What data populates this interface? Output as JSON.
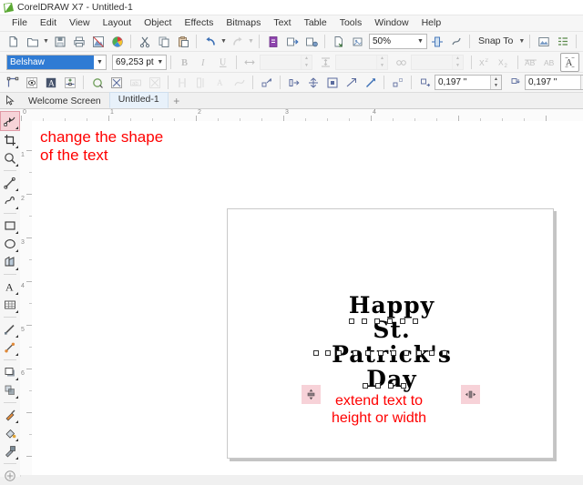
{
  "window": {
    "title": "CorelDRAW X7 - Untitled-1",
    "app_icon": "coreldraw-logo-icon"
  },
  "menubar": {
    "items": [
      {
        "label": "File"
      },
      {
        "label": "Edit"
      },
      {
        "label": "View"
      },
      {
        "label": "Layout"
      },
      {
        "label": "Object"
      },
      {
        "label": "Effects"
      },
      {
        "label": "Bitmaps"
      },
      {
        "label": "Text"
      },
      {
        "label": "Table"
      },
      {
        "label": "Tools"
      },
      {
        "label": "Window"
      },
      {
        "label": "Help"
      }
    ]
  },
  "standard_toolbar": {
    "buttons": [
      {
        "name": "new-document-button",
        "icon": "new-page-icon"
      },
      {
        "name": "open-document-button",
        "icon": "folder-open-icon"
      },
      {
        "name": "save-document-button",
        "icon": "floppy-disk-icon"
      },
      {
        "name": "print-button",
        "icon": "printer-icon"
      },
      {
        "name": "publish-pdf-button",
        "icon": "pdf-export-icon"
      },
      {
        "name": "color-styles-button",
        "icon": "color-wheel-icon"
      },
      {
        "name": "cut-button",
        "icon": "scissors-icon"
      },
      {
        "name": "copy-button",
        "icon": "copy-icon"
      },
      {
        "name": "paste-button",
        "icon": "clipboard-paste-icon"
      },
      {
        "name": "undo-button",
        "icon": "undo-arrow-icon"
      },
      {
        "name": "redo-button",
        "icon": "redo-arrow-icon"
      },
      {
        "name": "import-button",
        "icon": "import-icon"
      },
      {
        "name": "export-button",
        "icon": "export-icon"
      },
      {
        "name": "export-to-button",
        "icon": "export-to-icon"
      },
      {
        "name": "application-launcher-button",
        "icon": "launcher-icon"
      },
      {
        "name": "corel-connect-button",
        "icon": "connect-icon"
      }
    ],
    "zoom_level": "50%",
    "snap_to_label": "Snap To",
    "right_buttons": [
      {
        "name": "full-screen-preview-button",
        "icon": "preview-icon"
      },
      {
        "name": "object-manager-button",
        "icon": "object-list-icon"
      },
      {
        "name": "options-button",
        "icon": "options-icon"
      },
      {
        "name": "duplicate-distance-button",
        "icon": "duplicate-icon"
      }
    ]
  },
  "text_property_bar": {
    "font_name": "Belshaw",
    "font_size": "69,253 pt",
    "bold_label": "B",
    "italic_label": "I",
    "underline_label": "U",
    "character_spacing_value": "",
    "line_spacing_value": "",
    "word_spacing_value": "",
    "superscript_label": "X²",
    "subscript_label": "X₂",
    "all_caps_label": "AB",
    "small_caps_label": "AB",
    "buttons": [
      {
        "name": "bold-button",
        "icon": "bold-icon"
      },
      {
        "name": "italic-button",
        "icon": "italic-icon"
      },
      {
        "name": "underline-button",
        "icon": "underline-icon"
      },
      {
        "name": "character-spacing-field",
        "icon": "character-spacing-icon"
      },
      {
        "name": "line-spacing-field",
        "icon": "line-spacing-icon"
      },
      {
        "name": "word-spacing-field",
        "icon": "word-spacing-icon"
      },
      {
        "name": "superscript-button",
        "icon": "superscript-icon"
      },
      {
        "name": "subscript-button",
        "icon": "subscript-icon"
      },
      {
        "name": "uppercase-button",
        "icon": "uppercase-icon"
      },
      {
        "name": "small-caps-button",
        "icon": "small-caps-icon"
      },
      {
        "name": "character-panel-button",
        "icon": "character-panel-icon"
      },
      {
        "name": "add-option-button",
        "icon": "plus-circle-icon"
      }
    ]
  },
  "shape_property_bar": {
    "nudge_horizontal": "0,197 \"",
    "nudge_vertical": "0,197 \"",
    "buttons": [
      {
        "name": "select-all-nodes-button",
        "icon": "select-nodes-icon"
      },
      {
        "name": "preview-nodes-button",
        "icon": "nodes-grid-icon"
      },
      {
        "name": "convert-to-curves-button",
        "icon": "text-curve-icon"
      },
      {
        "name": "add-node-button",
        "icon": "add-node-icon"
      },
      {
        "name": "reduce-nodes-button",
        "icon": "reduce-node-icon"
      },
      {
        "name": "delete-node-button",
        "icon": "delete-node-icon"
      },
      {
        "name": "join-nodes-button",
        "icon": "join-nodes-icon"
      },
      {
        "name": "break-curve-button",
        "icon": "break-curve-icon"
      },
      {
        "name": "line-to-curve-button",
        "icon": "line-to-curve-icon"
      },
      {
        "name": "curve-to-line-button",
        "icon": "curve-to-line-icon"
      },
      {
        "name": "make-node-cusp-button",
        "icon": "cusp-node-icon"
      },
      {
        "name": "make-node-smooth-button",
        "icon": "smooth-node-icon"
      },
      {
        "name": "make-node-symmetric-button",
        "icon": "symmetric-node-icon"
      },
      {
        "name": "reverse-direction-button",
        "icon": "reverse-direction-icon"
      },
      {
        "name": "extend-curve-button",
        "icon": "extend-curve-icon"
      },
      {
        "name": "close-curve-button",
        "icon": "close-curve-icon"
      },
      {
        "name": "stretch-nodes-button",
        "icon": "stretch-nodes-icon"
      },
      {
        "name": "rotate-nodes-button",
        "icon": "rotate-nodes-icon"
      },
      {
        "name": "align-nodes-button",
        "icon": "align-nodes-icon"
      },
      {
        "name": "reflect-nodes-horizontal-button",
        "icon": "reflect-horizontal-icon"
      },
      {
        "name": "elastic-mode-button",
        "icon": "elastic-mode-icon"
      },
      {
        "name": "select-adjacent-nodes-button",
        "icon": "adjacent-nodes-icon"
      },
      {
        "name": "horizontal-nudge-field",
        "icon": "nudge-horizontal-icon"
      },
      {
        "name": "vertical-nudge-field",
        "icon": "nudge-vertical-icon"
      },
      {
        "name": "lock-ratio-button",
        "icon": "lock-icon"
      },
      {
        "name": "wrap-text-button",
        "icon": "wrap-text-icon"
      },
      {
        "name": "text-frame-button",
        "icon": "text-frame-icon"
      }
    ]
  },
  "tabs": {
    "cursor_icon": "pointer-icon",
    "items": [
      {
        "label": "Welcome Screen",
        "active": false
      },
      {
        "label": "Untitled-1",
        "active": true
      }
    ],
    "add_tab_label": "+"
  },
  "toolbox": {
    "tools": [
      {
        "name": "shape-tool",
        "icon": "shape-node-icon",
        "active": true
      },
      {
        "name": "crop-tool",
        "icon": "crop-icon",
        "active": false
      },
      {
        "name": "zoom-tool",
        "icon": "magnifier-icon",
        "active": false
      },
      {
        "name": "freehand-tool",
        "icon": "freehand-line-icon",
        "active": false
      },
      {
        "name": "artistic-media-tool",
        "icon": "artistic-brush-icon",
        "active": false
      },
      {
        "name": "rectangle-tool",
        "icon": "rectangle-icon",
        "active": false
      },
      {
        "name": "ellipse-tool",
        "icon": "ellipse-icon",
        "active": false
      },
      {
        "name": "polygon-tool",
        "icon": "polygon-icon",
        "active": false
      },
      {
        "name": "text-tool",
        "icon": "text-a-icon",
        "active": false
      },
      {
        "name": "table-tool",
        "icon": "table-icon",
        "active": false
      },
      {
        "name": "parallel-dimension-tool",
        "icon": "dimension-icon",
        "active": false
      },
      {
        "name": "straight-line-connector-tool",
        "icon": "connector-icon",
        "active": false
      },
      {
        "name": "drop-shadow-tool",
        "icon": "drop-shadow-icon",
        "active": false
      },
      {
        "name": "transparency-tool",
        "icon": "transparency-icon",
        "active": false
      },
      {
        "name": "color-eyedropper-tool",
        "icon": "eyedropper-icon",
        "active": false
      },
      {
        "name": "fill-tool",
        "icon": "fill-bucket-icon",
        "active": false
      },
      {
        "name": "outline-tool",
        "icon": "outline-pen-icon",
        "active": false
      },
      {
        "name": "quick-customize-button",
        "icon": "plus-circle-icon",
        "active": false
      }
    ]
  },
  "rulers": {
    "horizontal_labels": [
      "0",
      "1",
      "2",
      "3",
      "4"
    ],
    "vertical_labels": [
      "1",
      "2",
      "3",
      "4",
      "5",
      "6"
    ],
    "units": "inches"
  },
  "canvas": {
    "annotation_top": "change the shape\nof the text",
    "annotation_bottom": "extend text to\nheight or width",
    "annotation_color": "#ff0000",
    "artwork": {
      "line1": "Happy",
      "line2": "St. Patrick's",
      "line3": "Day",
      "font": "Belshaw",
      "color": "#000000"
    },
    "handles": [
      {
        "name": "vertical-scale-handle",
        "icon": "scale-vertical-icon",
        "color": "#f7d2d8"
      },
      {
        "name": "horizontal-scale-handle",
        "icon": "scale-horizontal-icon",
        "color": "#f7d2d8"
      }
    ]
  }
}
